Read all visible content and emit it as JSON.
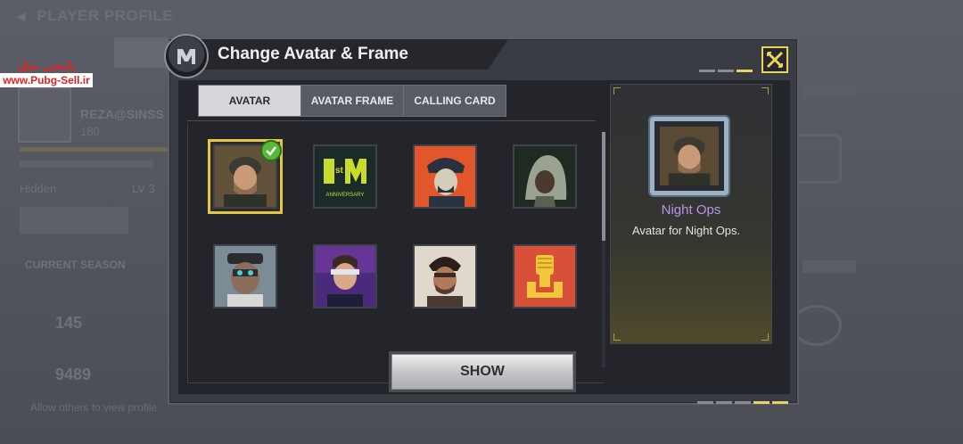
{
  "background": {
    "title": "PLAYER PROFILE",
    "player_name": "REZA@SINSS",
    "player_level": "180",
    "status": "Hidden",
    "lv": "LV 3",
    "season_label": "CURRENT SEASON",
    "stat_1": "145",
    "stat_2": "9489",
    "hint": "Allow others to view profile"
  },
  "watermark": {
    "line1": "پابجی سل",
    "line2": "www.Pubg-Sell.ir"
  },
  "dialog": {
    "title": "Change Avatar & Frame",
    "tabs": [
      {
        "label": "AVATAR",
        "active": true
      },
      {
        "label": "AVATAR FRAME",
        "active": false
      },
      {
        "label": "CALLING CARD",
        "active": false
      }
    ],
    "avatars": [
      {
        "icon": "night-ops-soldier-avatar-icon",
        "selected": true
      },
      {
        "icon": "1st-anniversary-avatar-icon",
        "selected": false,
        "text": "ANNIVERSARY"
      },
      {
        "icon": "ushanka-soldier-avatar-icon",
        "selected": false
      },
      {
        "icon": "ghillie-hood-avatar-icon",
        "selected": false
      },
      {
        "icon": "goggled-soldier-avatar-icon",
        "selected": false
      },
      {
        "icon": "cyber-visor-avatar-icon",
        "selected": false
      },
      {
        "icon": "masked-warrior-avatar-icon",
        "selected": false
      },
      {
        "icon": "fist-emblem-avatar-icon",
        "selected": false
      }
    ],
    "detail": {
      "name": "Night Ops",
      "description": "Avatar for Night Ops."
    },
    "show_label": "SHOW"
  },
  "colors": {
    "accent_yellow": "#e4c544",
    "selected_check": "#58b838",
    "item_name_purple": "#b894e8"
  }
}
